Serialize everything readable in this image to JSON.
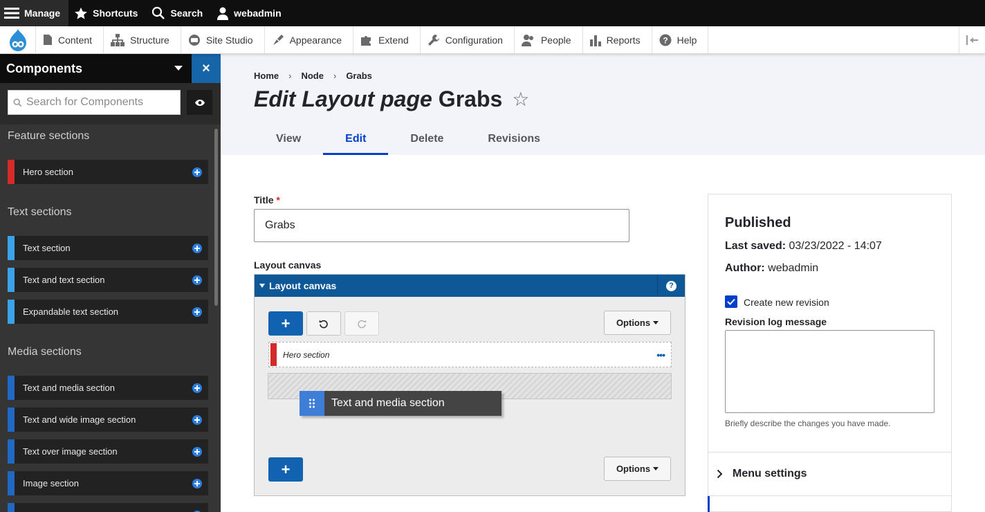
{
  "toolbar": {
    "manage": "Manage",
    "shortcuts": "Shortcuts",
    "search": "Search",
    "user": "webadmin"
  },
  "tray": {
    "items": [
      "Content",
      "Structure",
      "Site Studio",
      "Appearance",
      "Extend",
      "Configuration",
      "People",
      "Reports",
      "Help"
    ]
  },
  "sidebar": {
    "title": "Components",
    "close": "×",
    "search_placeholder": "Search for Components",
    "groups": [
      {
        "title": "Feature sections",
        "items": [
          {
            "label": "Hero section",
            "color": "#d42a2a"
          }
        ]
      },
      {
        "title": "Text sections",
        "items": [
          {
            "label": "Text section",
            "color": "#3aa2e8"
          },
          {
            "label": "Text and text section",
            "color": "#3aa2e8"
          },
          {
            "label": "Expandable text section",
            "color": "#3aa2e8"
          }
        ]
      },
      {
        "title": "Media sections",
        "items": [
          {
            "label": "Text and media section",
            "color": "#1f68c3"
          },
          {
            "label": "Text and wide image section",
            "color": "#1f68c3"
          },
          {
            "label": "Text over image section",
            "color": "#1f68c3"
          },
          {
            "label": "Image section",
            "color": "#1f68c3"
          }
        ]
      }
    ]
  },
  "breadcrumb": [
    "Home",
    "Node",
    "Grabs"
  ],
  "page": {
    "title_prefix": "Edit Layout page",
    "title_name": "Grabs",
    "star": "☆"
  },
  "tabs": [
    "View",
    "Edit",
    "Delete",
    "Revisions"
  ],
  "active_tab": "Edit",
  "form": {
    "title_label": "Title",
    "required_mark": "*",
    "title_value": "Grabs",
    "canvas_label": "Layout canvas",
    "canvas_header": "Layout canvas",
    "help": "?",
    "add": "+",
    "options": "Options",
    "hero_row": "Hero section",
    "hero_dots": "•••",
    "drag_item": "Text and media section"
  },
  "meta": {
    "status": "Published",
    "last_saved_label": "Last saved:",
    "last_saved_value": "03/23/2022 - 14:07",
    "author_label": "Author:",
    "author_value": "webadmin",
    "revision_checkbox": "Create new revision",
    "revision_checked": true,
    "revision_log_label": "Revision log message",
    "revision_log_value": "",
    "revision_desc": "Briefly describe the changes you have made.",
    "menu_settings": "Menu settings"
  }
}
